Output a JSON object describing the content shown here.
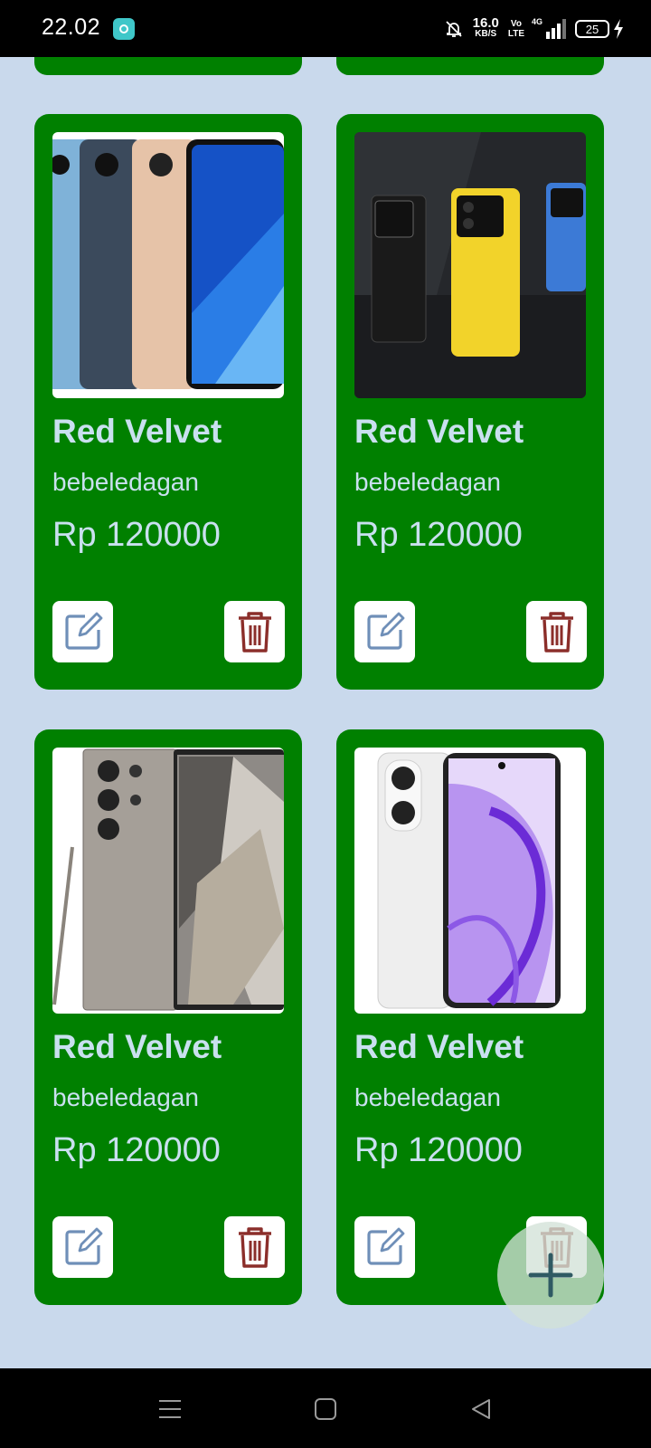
{
  "status_bar": {
    "time": "22.02",
    "net_speed_value": "16.0",
    "net_speed_unit": "KB/S",
    "volte_top": "Vo",
    "volte_bottom": "LTE",
    "network_type": "4G",
    "battery_level": "25"
  },
  "products": [
    {
      "name": "Red Velvet",
      "description": "bebeledagan",
      "price": "Rp 120000",
      "image": "infinix-phones-photo"
    },
    {
      "name": "Red Velvet",
      "description": "bebeledagan",
      "price": "Rp 120000",
      "image": "poco-phones-photo"
    },
    {
      "name": "Red Velvet",
      "description": "bebeledagan",
      "price": "Rp 120000",
      "image": "samsung-phone-photo"
    },
    {
      "name": "Red Velvet",
      "description": "bebeledagan",
      "price": "Rp 120000",
      "image": "oppo-phone-photo"
    }
  ],
  "actions": {
    "edit_icon": "edit-icon",
    "delete_icon": "trash-icon",
    "fab_icon": "plus-icon"
  },
  "colors": {
    "background": "#c9d9ec",
    "card": "#008000",
    "card_text": "#c9e0ef",
    "edit_icon": "#6f8fb8",
    "delete_icon": "#8b2e2a"
  },
  "navigation": [
    "menu-icon",
    "home-icon",
    "back-icon"
  ]
}
